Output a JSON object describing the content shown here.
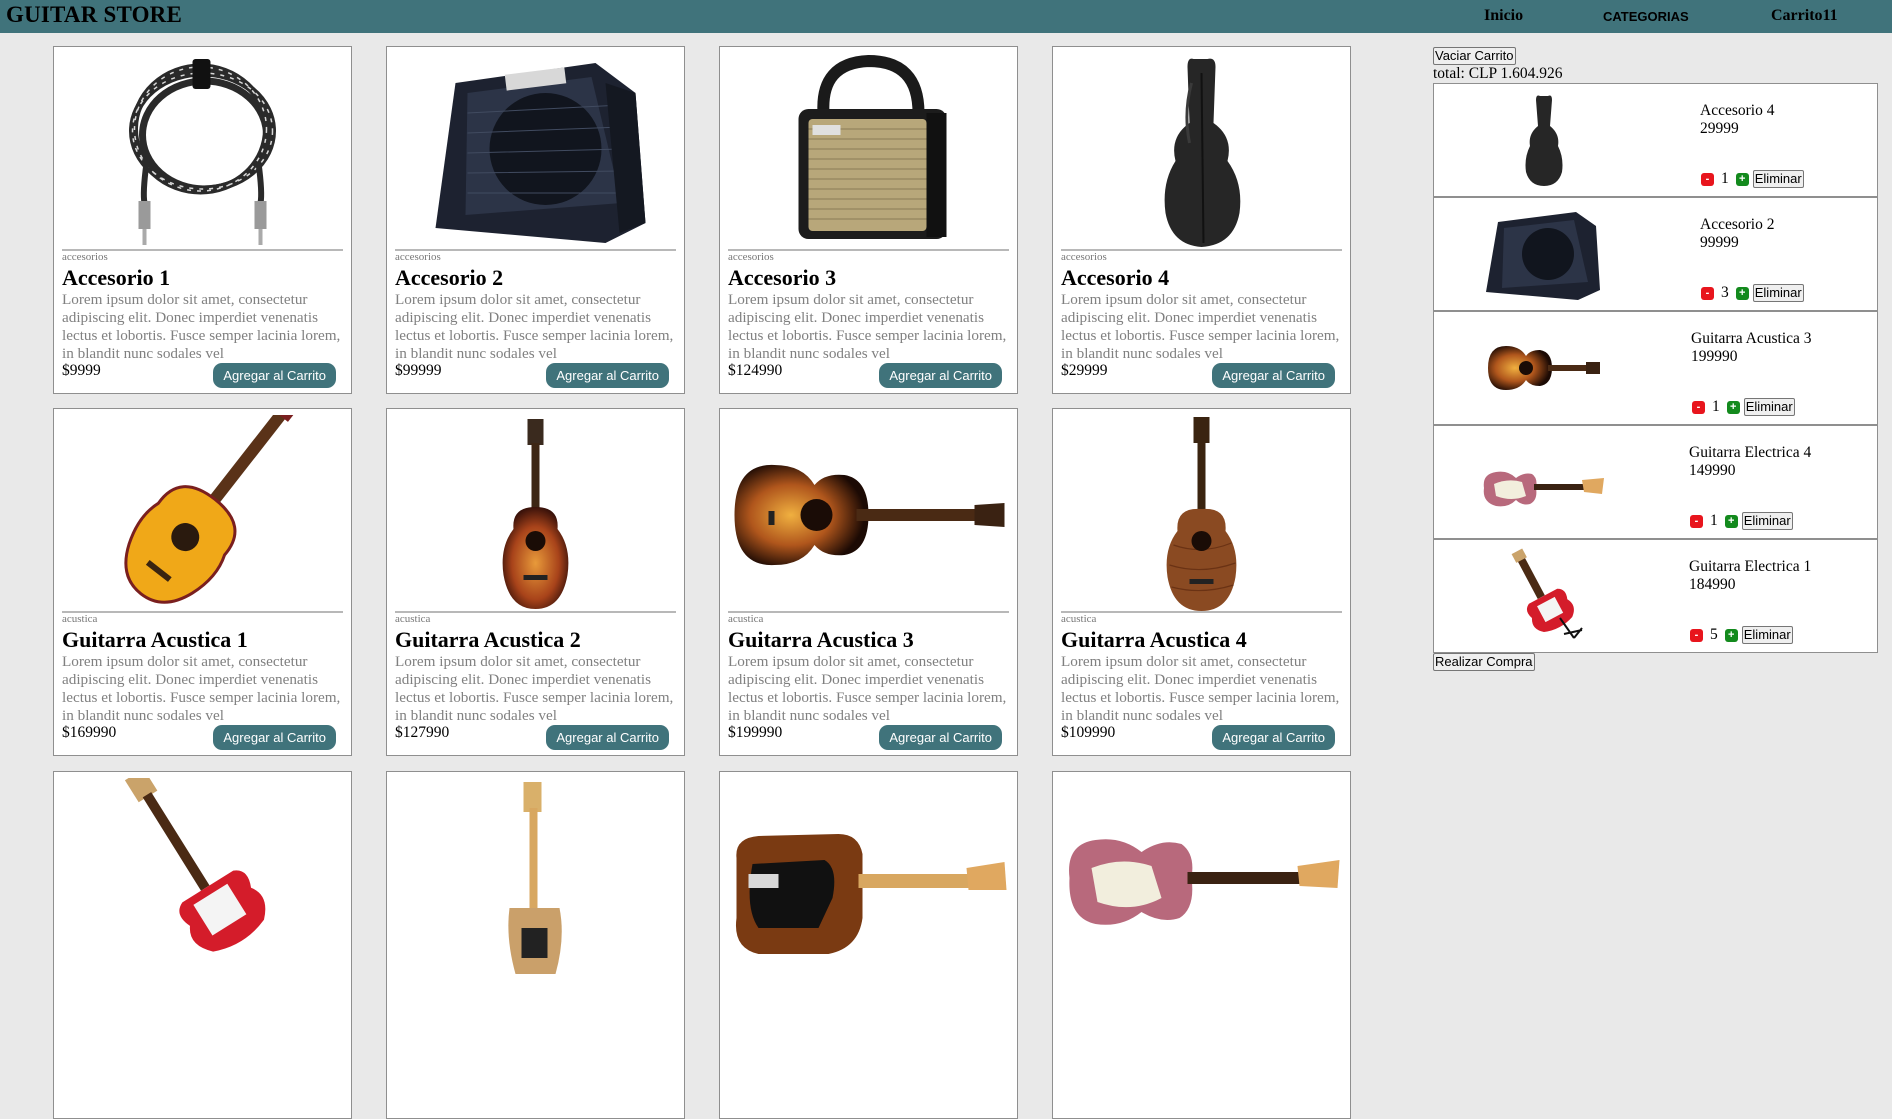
{
  "navbar": {
    "brand": "GUITAR STORE",
    "links": {
      "home": "Inicio",
      "categories": "CATEGORIAS",
      "cart": "Carrito",
      "cart_count": "11"
    }
  },
  "products": [
    {
      "category": "accesorios",
      "title": "Accesorio 1",
      "price": "$9999",
      "button": "Agregar al Carrito",
      "image": "cable-icon"
    },
    {
      "category": "accesorios",
      "title": "Accesorio 2",
      "price": "$99999",
      "button": "Agregar al Carrito",
      "image": "amplifier-icon"
    },
    {
      "category": "accesorios",
      "title": "Accesorio 3",
      "price": "$124990",
      "button": "Agregar al Carrito",
      "image": "small-amplifier-icon"
    },
    {
      "category": "accesorios",
      "title": "Accesorio 4",
      "price": "$29999",
      "button": "Agregar al Carrito",
      "image": "gig-bag-icon"
    },
    {
      "category": "acustica",
      "title": "Guitarra Acustica 1",
      "price": "$169990",
      "button": "Agregar al Carrito",
      "image": "yellow-classical-guitar-icon"
    },
    {
      "category": "acustica",
      "title": "Guitarra Acustica 2",
      "price": "$127990",
      "button": "Agregar al Carrito",
      "image": "sunburst-mini-guitar-icon"
    },
    {
      "category": "acustica",
      "title": "Guitarra Acustica 3",
      "price": "$199990",
      "button": "Agregar al Carrito",
      "image": "sunburst-acoustic-guitar-icon"
    },
    {
      "category": "acustica",
      "title": "Guitarra Acustica 4",
      "price": "$109990",
      "button": "Agregar al Carrito",
      "image": "wood-acoustic-guitar-icon"
    },
    {
      "image": "red-electric-guitar-icon"
    },
    {
      "image": "natural-telecaster-icon"
    },
    {
      "image": "brown-telecaster-icon"
    },
    {
      "image": "pink-stratocaster-icon"
    }
  ],
  "description": "Lorem ipsum dolor sit amet, consectetur adipiscing elit. Donec imperdiet venenatis lectus et lobortis. Fusce semper lacinia lorem, in blandit nunc sodales vel",
  "cart": {
    "empty_label": "Vaciar Carrito",
    "total_label": "total: CLP 1.604.926",
    "remove_label": "Eliminar",
    "minus": "-",
    "plus": "+",
    "buy_label": "Realizar Compra",
    "items": [
      {
        "name": "Accesorio 4",
        "price": "29999",
        "qty": "1",
        "image": "gig-bag-icon"
      },
      {
        "name": "Accesorio 2",
        "price": "99999",
        "qty": "3",
        "image": "amplifier-icon"
      },
      {
        "name": "Guitarra Acustica 3",
        "price": "199990",
        "qty": "1",
        "image": "sunburst-acoustic-guitar-icon"
      },
      {
        "name": "Guitarra Electrica 4",
        "price": "149990",
        "qty": "1",
        "image": "pink-stratocaster-icon"
      },
      {
        "name": "Guitarra Electrica 1",
        "price": "184990",
        "qty": "5",
        "image": "red-electric-guitar-icon"
      }
    ]
  }
}
